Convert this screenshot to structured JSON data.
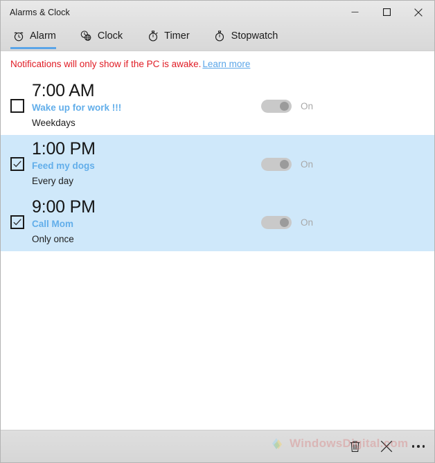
{
  "window": {
    "title": "Alarms & Clock",
    "caption": {
      "minimize": "minimize-icon",
      "maximize": "maximize-icon",
      "close": "close-icon"
    }
  },
  "tabs": [
    {
      "label": "Alarm",
      "icon": "alarm-clock-icon",
      "active": true
    },
    {
      "label": "Clock",
      "icon": "world-clock-icon",
      "active": false
    },
    {
      "label": "Timer",
      "icon": "timer-icon",
      "active": false
    },
    {
      "label": "Stopwatch",
      "icon": "stopwatch-icon",
      "active": false
    }
  ],
  "notice": {
    "message": "Notifications will only show if the PC is awake.",
    "link_label": "Learn more",
    "text_color": "#e01b24",
    "link_color": "#5aa5e8"
  },
  "alarms": [
    {
      "time": "7:00 AM",
      "name": "Wake up for work !!!",
      "repeat": "Weekdays",
      "checked": false,
      "selected": false,
      "toggle_label": "On",
      "toggle_on": true
    },
    {
      "time": "1:00 PM",
      "name": "Feed my dogs",
      "repeat": "Every day",
      "checked": true,
      "selected": true,
      "toggle_label": "On",
      "toggle_on": true
    },
    {
      "time": "9:00 PM",
      "name": "Call Mom",
      "repeat": "Only once",
      "checked": true,
      "selected": true,
      "toggle_label": "On",
      "toggle_on": true
    }
  ],
  "commandbar": {
    "delete_icon": "trash-icon",
    "cancel_icon": "close-icon",
    "more_icon": "more-dots-icon"
  },
  "watermark": {
    "text": "WindowsDigital.com"
  },
  "colors": {
    "selection": "#cfe8fa",
    "accent": "#5aa5e8",
    "alarm_name": "#62aeea",
    "toggle_track": "#c9c9c9",
    "toggle_knob": "#9b9b9b"
  }
}
